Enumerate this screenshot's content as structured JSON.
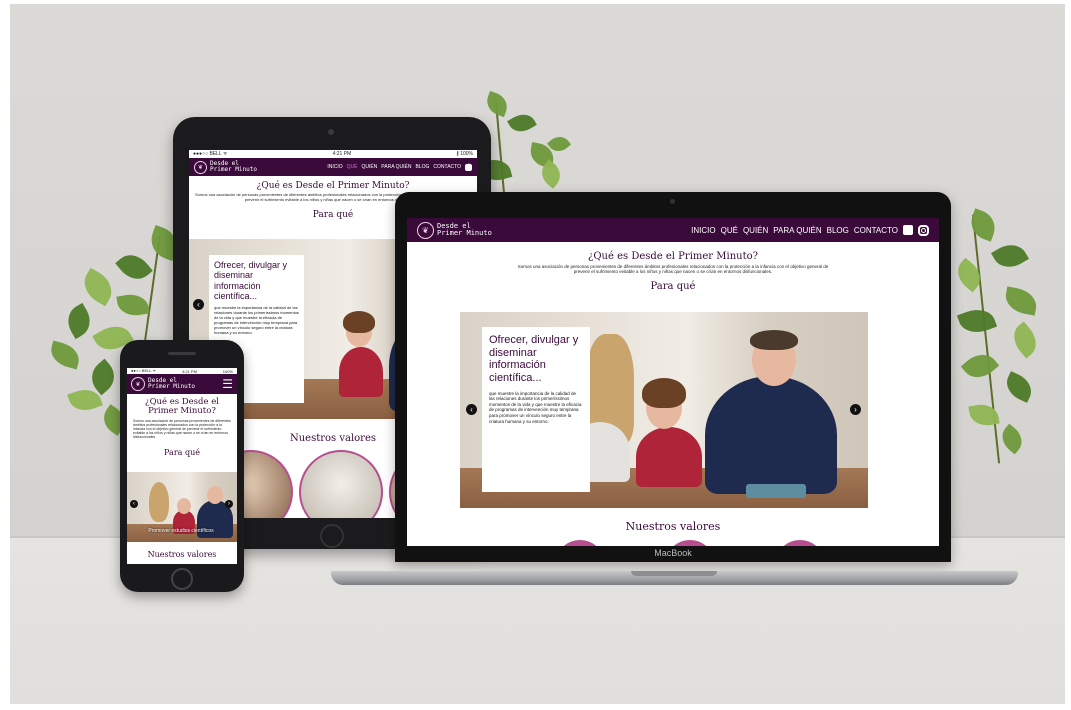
{
  "site": {
    "logo_line1": "Desde el",
    "logo_line2": "Primer Minuto",
    "nav_items": [
      "INICIO",
      "QUÉ",
      "QUIÉN",
      "PARA QUIÉN",
      "BLOG",
      "CONTACTO"
    ],
    "social_icons": [
      "facebook-icon",
      "instagram-icon"
    ],
    "heading": "¿Qué es Desde el Primer Minuto?",
    "intro": "Somos una asociación de personas provenientes de diferentes ámbitos profesionales relacionados con la protección a la infancia con el objetivo general de prevenir el sufrimiento evitable a los niños y niñas que nacen o se crían en entornos disfuncionales.",
    "section_title": "Para qué",
    "card_title": "Ofrecer, divulgar y diseminar información científica...",
    "card_text": "que muestre la importancia de la calidad de las relaciones durante los primeríssimos momentos de la vida y que muestre la eficacia de programas de intervención muy temprana para promover un vínculo seguro entre la criatura humana y su entorno.",
    "values_title": "Nuestros valores",
    "phone_caption": "Promover estudios científicos"
  },
  "tablet_status": {
    "carrier": "●●●○○ BELL ᯤ",
    "time": "4:21 PM",
    "battery": "∦ 100%"
  },
  "phone_status": {
    "carrier": "●●○○ BELL ᯤ",
    "time": "4:21 PM",
    "battery": "100%"
  },
  "laptop_brand": "MacBook",
  "colors": {
    "brand": "#3a0b3a",
    "accent": "#d66ad0",
    "ring": "#b64f8f"
  }
}
